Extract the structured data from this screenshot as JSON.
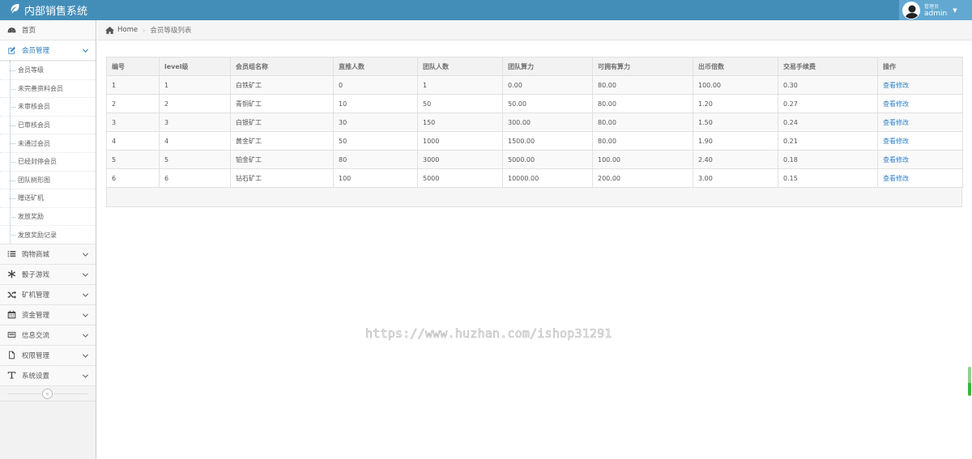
{
  "app": {
    "title": "内部销售系统"
  },
  "user": {
    "role": "管理员",
    "name": "admin"
  },
  "sidebar": {
    "items": [
      {
        "label": "首页",
        "icon": "dashboard-icon"
      },
      {
        "label": "会员管理",
        "icon": "edit-icon",
        "expanded": true
      },
      {
        "label": "购物商城",
        "icon": "list-icon"
      },
      {
        "label": "骰子游戏",
        "icon": "asterisk-icon"
      },
      {
        "label": "矿机管理",
        "icon": "random-icon"
      },
      {
        "label": "资金管理",
        "icon": "calendar-icon"
      },
      {
        "label": "信息交流",
        "icon": "card-icon"
      },
      {
        "label": "权限管理",
        "icon": "file-icon"
      },
      {
        "label": "系统设置",
        "icon": "text-icon"
      }
    ],
    "submenu": [
      "会员等级",
      "未完善资料会员",
      "未审核会员",
      "已审核会员",
      "未通过会员",
      "已经封停会员",
      "团队树形图",
      "赠送矿机",
      "发放奖励",
      "发放奖励记录"
    ]
  },
  "breadcrumb": {
    "home": "Home",
    "current": "会员等级列表"
  },
  "table": {
    "headers": [
      "编号",
      "level级",
      "会员组名称",
      "直推人数",
      "团队人数",
      "团队算力",
      "可拥有算力",
      "出币倍数",
      "交易手续费",
      "操作"
    ],
    "rows": [
      [
        "1",
        "1",
        "白铁矿工",
        "0",
        "1",
        "0.00",
        "80.00",
        "100.00",
        "0.30",
        "查看修改"
      ],
      [
        "2",
        "2",
        "青铜矿工",
        "10",
        "50",
        "50.00",
        "80.00",
        "1.20",
        "0.27",
        "查看修改"
      ],
      [
        "3",
        "3",
        "白银矿工",
        "30",
        "150",
        "300.00",
        "80.00",
        "1.50",
        "0.24",
        "查看修改"
      ],
      [
        "4",
        "4",
        "黄金矿工",
        "50",
        "1000",
        "1500.00",
        "80.00",
        "1.90",
        "0.21",
        "查看修改"
      ],
      [
        "5",
        "5",
        "铂金矿工",
        "80",
        "3000",
        "5000.00",
        "100.00",
        "2.40",
        "0.18",
        "查看修改"
      ],
      [
        "6",
        "6",
        "钻石矿工",
        "100",
        "5000",
        "10000.00",
        "200.00",
        "3.00",
        "0.15",
        "查看修改"
      ]
    ]
  },
  "watermark": "https://www.huzhan.com/ishop31291",
  "colors": {
    "navbar": "#438eb9",
    "user_box": "#62a8d1",
    "link": "#3182c8",
    "active_menu": "#2b7dbc"
  }
}
